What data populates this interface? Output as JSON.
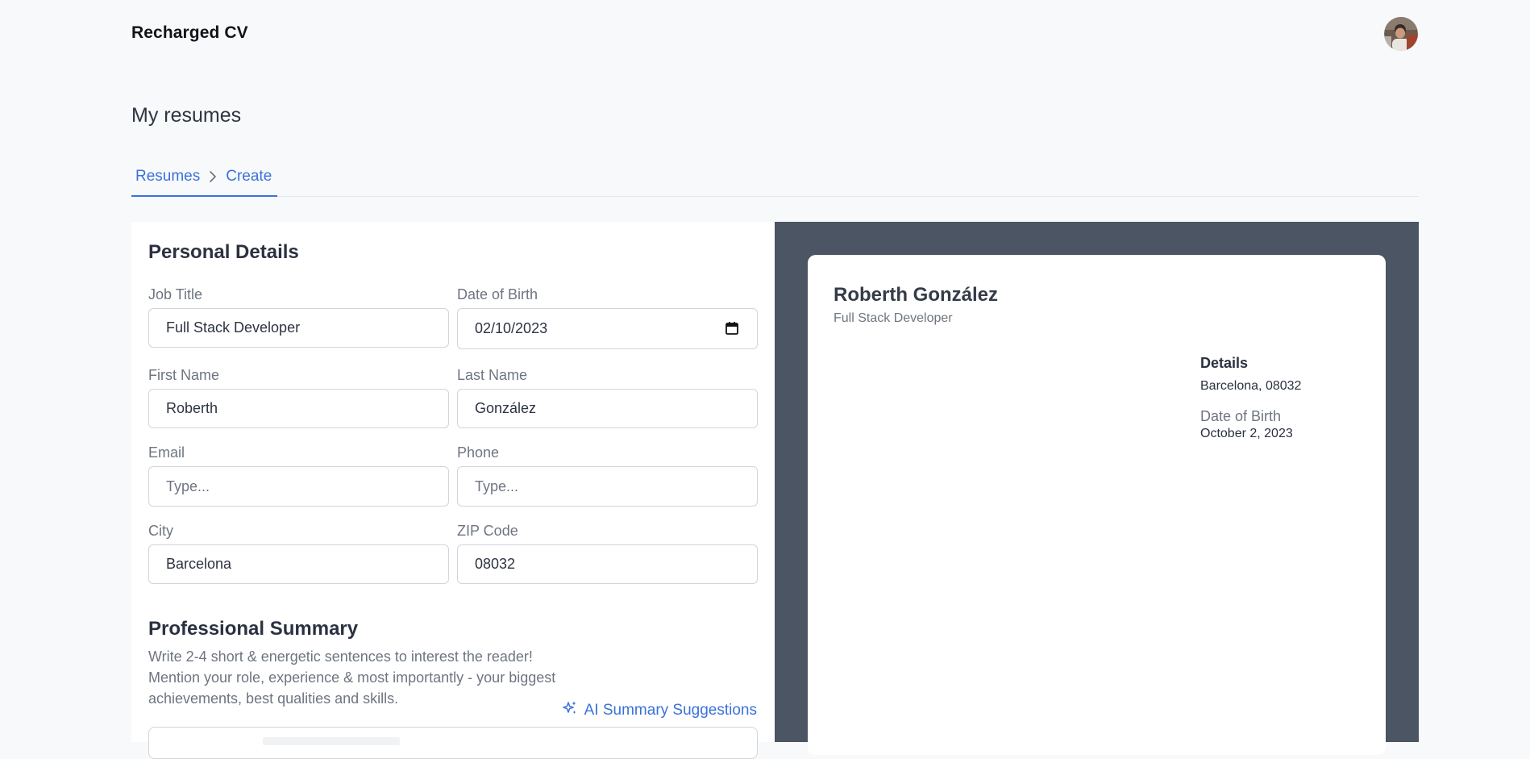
{
  "app": {
    "brand": "Recharged CV"
  },
  "page": {
    "title": "My resumes"
  },
  "breadcrumb": {
    "items": [
      "Resumes",
      "Create"
    ]
  },
  "personal_details": {
    "title": "Personal Details",
    "fields": {
      "job_title": {
        "label": "Job Title",
        "value": "Full Stack Developer"
      },
      "date_of_birth": {
        "label": "Date of Birth",
        "value": "02/10/2023"
      },
      "first_name": {
        "label": "First Name",
        "value": "Roberth"
      },
      "last_name": {
        "label": "Last Name",
        "value": "González"
      },
      "email": {
        "label": "Email",
        "placeholder": "Type..."
      },
      "phone": {
        "label": "Phone",
        "placeholder": "Type..."
      },
      "city": {
        "label": "City",
        "value": "Barcelona"
      },
      "zip": {
        "label": "ZIP Code",
        "value": "08032"
      }
    }
  },
  "professional_summary": {
    "title": "Professional Summary",
    "help": "Write 2-4 short & energetic sentences to interest the reader! Mention your role, experience & most importantly - your biggest achievements, best qualities and skills.",
    "ai_link": "AI Summary Suggestions"
  },
  "preview": {
    "name": "Roberth González",
    "job_title": "Full Stack Developer",
    "details_title": "Details",
    "location": "Barcelona, 08032",
    "dob_label": "Date of Birth",
    "dob": "October 2, 2023"
  },
  "colors": {
    "accent": "#3b72d9",
    "background": "#f8f9fb",
    "preview_background": "#4b5563"
  }
}
